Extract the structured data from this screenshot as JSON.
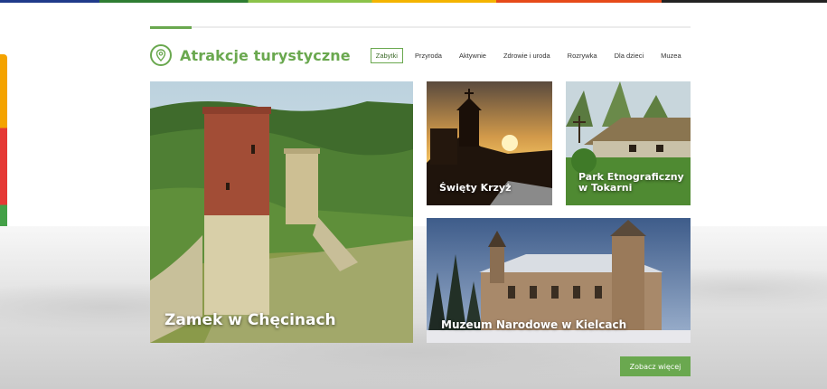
{
  "section": {
    "title": "Atrakcje turystyczne",
    "icon": "map-pin-icon",
    "accent_color": "#6aa84f"
  },
  "tabs": [
    {
      "label": "Zabytki",
      "active": true
    },
    {
      "label": "Przyroda",
      "active": false
    },
    {
      "label": "Aktywnie",
      "active": false
    },
    {
      "label": "Zdrowie i uroda",
      "active": false
    },
    {
      "label": "Rozrywka",
      "active": false
    },
    {
      "label": "Dla dzieci",
      "active": false
    },
    {
      "label": "Muzea",
      "active": false
    }
  ],
  "cards": {
    "zamek": {
      "label": "Zamek w Chęcinach"
    },
    "krzyz": {
      "label": "Święty Krzyż"
    },
    "park": {
      "label": "Park Etnograficzny w Tokarni"
    },
    "muzeum": {
      "label": "Muzeum Narodowe w Kielcach"
    }
  },
  "more_button": {
    "label": "Zobacz więcej"
  }
}
